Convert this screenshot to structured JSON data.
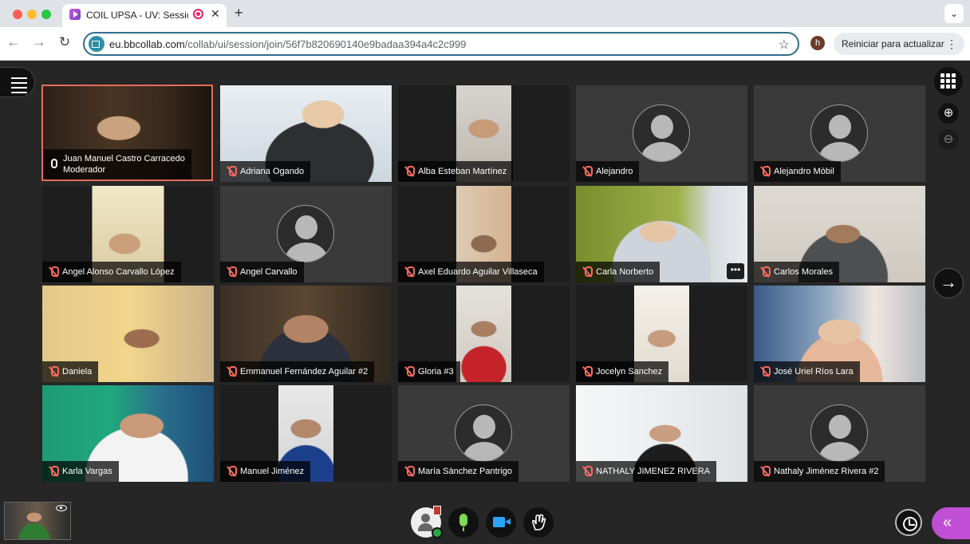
{
  "browser": {
    "tab_title": "COIL UPSA - UV: Session",
    "url_host": "eu.bbcollab.com",
    "url_path": "/collab/ui/session/join/56f7b820690140e9badaa394a4c2c999",
    "profile_initial": "h",
    "update_button": "Reiniciar para actualizar"
  },
  "participants": [
    {
      "name": "Juan Manuel Castro Carracedo",
      "role": "Moderador",
      "mic": "on",
      "video": true
    },
    {
      "name": "Adriana Ogando",
      "mic": "muted",
      "video": true
    },
    {
      "name": "Alba Esteban Martínez",
      "mic": "muted",
      "video": true
    },
    {
      "name": "Alejandro",
      "mic": "muted",
      "video": false
    },
    {
      "name": "Alejandro Mòbil",
      "mic": "muted",
      "video": false
    },
    {
      "name": "Angel Alonso Carvallo López",
      "mic": "muted",
      "video": true
    },
    {
      "name": "Angel Carvallo",
      "mic": "muted",
      "video": false
    },
    {
      "name": "Axel Eduardo Aguilar Villaseca",
      "mic": "muted",
      "video": true
    },
    {
      "name": "Carla Norberto",
      "mic": "muted",
      "video": true
    },
    {
      "name": "Carlos Morales",
      "mic": "muted",
      "video": true
    },
    {
      "name": "Daniela",
      "mic": "muted",
      "video": true
    },
    {
      "name": "Emmanuel Fernández Aguilar #2",
      "mic": "muted",
      "video": true
    },
    {
      "name": "Gloria #3",
      "mic": "muted",
      "video": true
    },
    {
      "name": "Jocelyn Sanchez",
      "mic": "muted",
      "video": true
    },
    {
      "name": "José Uriel Ríos Lara",
      "mic": "muted",
      "video": true
    },
    {
      "name": "Karla Vargas",
      "mic": "muted",
      "video": true
    },
    {
      "name": "Manuel Jiménez",
      "mic": "muted",
      "video": true
    },
    {
      "name": "María Sánchez Pantrigo",
      "mic": "muted",
      "video": false
    },
    {
      "name": "NATHALY JIMENEZ RIVERA",
      "mic": "muted",
      "video": true
    },
    {
      "name": "Nathaly Jiménez Rivera #2",
      "mic": "muted",
      "video": false
    }
  ],
  "icons": {
    "menu": "hamburger-icon",
    "grid": "grid-view-icon",
    "zoom_in": "zoom-in-icon",
    "zoom_out": "zoom-out-icon",
    "next": "arrow-right-icon",
    "mic": "microphone-icon",
    "camera": "camera-icon",
    "hand": "raise-hand-icon",
    "timer": "timer-icon",
    "panel": "collapse-panel-icon"
  },
  "colors": {
    "moderator_border": "#e56c5a",
    "muted_mic": "#ff6b5e",
    "mic_active": "#7ed957",
    "camera_active": "#29a3ff",
    "panel_accent": "#c14fd6"
  }
}
